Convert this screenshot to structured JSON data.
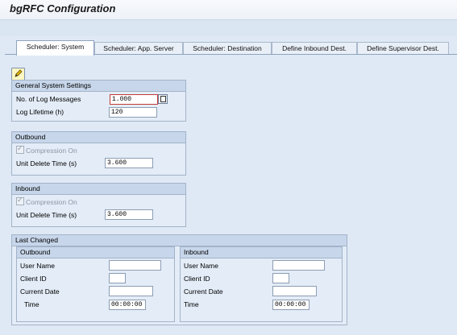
{
  "title": "bgRFC Configuration",
  "tabs": [
    {
      "label": "Scheduler: System"
    },
    {
      "label": "Scheduler: App. Server"
    },
    {
      "label": "Scheduler: Destination"
    },
    {
      "label": "Define Inbound Dest."
    },
    {
      "label": "Define Supervisor Dest."
    }
  ],
  "general": {
    "header": "General System Settings",
    "log_messages_label": "No. of Log Messages",
    "log_messages_value": "1.000",
    "log_lifetime_label": "Log Lifetime (h)",
    "log_lifetime_value": "120"
  },
  "outbound": {
    "header": "Outbound",
    "compression_label": "Compression On",
    "compression_checked": true,
    "unit_delete_label": "Unit Delete Time (s)",
    "unit_delete_value": "3.600"
  },
  "inbound": {
    "header": "Inbound",
    "compression_label": "Compression On",
    "compression_checked": true,
    "unit_delete_label": "Unit Delete Time (s)",
    "unit_delete_value": "3.600"
  },
  "last_changed": {
    "header": "Last Changed",
    "outbound": {
      "header": "Outbound",
      "user_name_label": "User Name",
      "user_name_value": "",
      "client_label": "Client ID",
      "client_value": "",
      "date_label": "Current Date",
      "date_value": "",
      "time_label": "Time",
      "time_value": "00:00:00"
    },
    "inbound": {
      "header": "Inbound",
      "user_name_label": "User Name",
      "user_name_value": "",
      "client_label": "Client ID",
      "client_value": "",
      "date_label": "Current Date",
      "date_value": "",
      "time_label": "Time",
      "time_value": "00:00:00"
    }
  },
  "icons": {
    "edit": "pencil-icon",
    "help": "value-help-icon"
  }
}
